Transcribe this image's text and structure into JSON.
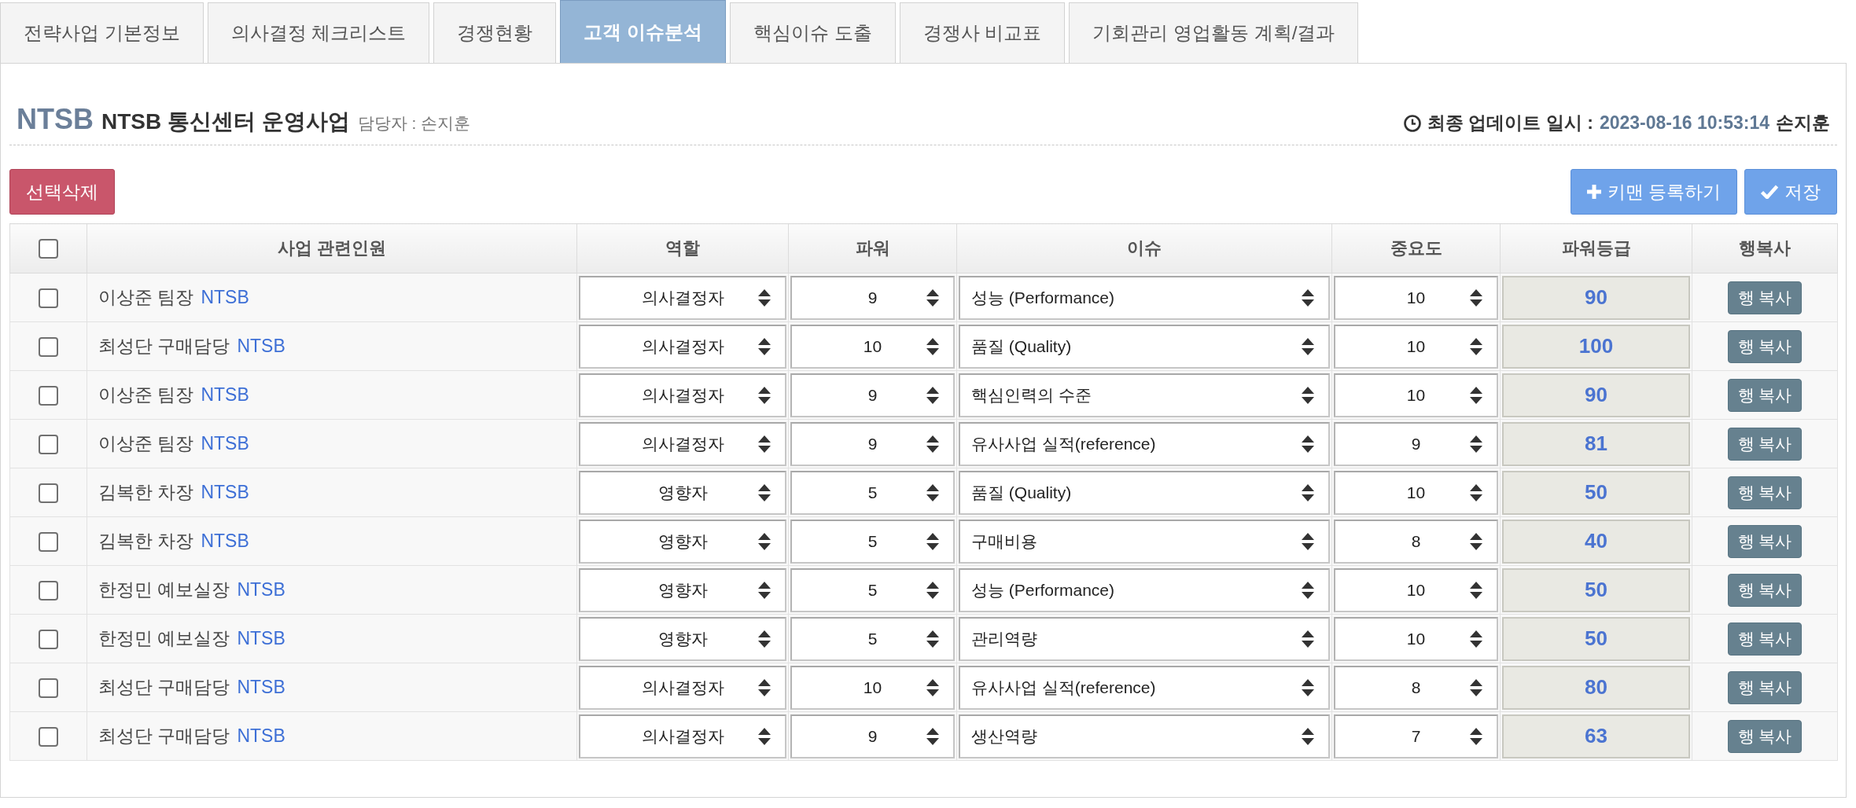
{
  "tabs": [
    {
      "label": "전략사업 기본정보",
      "selected": false
    },
    {
      "label": "의사결정 체크리스트",
      "selected": false
    },
    {
      "label": "경쟁현황",
      "selected": false
    },
    {
      "label": "고객 이슈분석",
      "selected": true
    },
    {
      "label": "핵심이슈 도출",
      "selected": false
    },
    {
      "label": "경쟁사 비교표",
      "selected": false
    },
    {
      "label": "기회관리 영업활동 계획/결과",
      "selected": false
    }
  ],
  "project": {
    "code": "NTSB",
    "title": "NTSB 통신센터 운영사업",
    "manager": "담당자 : 손지훈"
  },
  "last_update": {
    "label": "최종 업데이트 일시 :",
    "timestamp": "2023-08-16 10:53:14",
    "user": "손지훈"
  },
  "actions": [
    {
      "kind": "delete",
      "label": "선택삭제"
    },
    {
      "kind": "add",
      "label": "키맨 등록하기"
    },
    {
      "kind": "save",
      "label": "저장"
    }
  ],
  "table": {
    "select_all": {
      "checked": false
    },
    "columns": [
      "사업 관련인원",
      "역할",
      "파워",
      "이슈",
      "중요도",
      "파워등급",
      "행복사"
    ],
    "rows": [
      {
        "checked": false,
        "person": "이상준 팀장",
        "company": "NTSB",
        "role": "의사결정자",
        "power": "9",
        "issue": "성능 (Performance)",
        "importance": "10",
        "power_grade": "90",
        "copy_button": "행 복사"
      },
      {
        "checked": false,
        "person": "최성단 구매담당",
        "company": "NTSB",
        "role": "의사결정자",
        "power": "10",
        "issue": "품질 (Quality)",
        "importance": "10",
        "power_grade": "100",
        "copy_button": "행 복사"
      },
      {
        "checked": false,
        "person": "이상준 팀장",
        "company": "NTSB",
        "role": "의사결정자",
        "power": "9",
        "issue": "핵심인력의 수준",
        "importance": "10",
        "power_grade": "90",
        "copy_button": "행 복사"
      },
      {
        "checked": false,
        "person": "이상준 팀장",
        "company": "NTSB",
        "role": "의사결정자",
        "power": "9",
        "issue": "유사사업 실적(reference)",
        "importance": "9",
        "power_grade": "81",
        "copy_button": "행 복사"
      },
      {
        "checked": false,
        "person": "김복한 차장",
        "company": "NTSB",
        "role": "영향자",
        "power": "5",
        "issue": "품질 (Quality)",
        "importance": "10",
        "power_grade": "50",
        "copy_button": "행 복사"
      },
      {
        "checked": false,
        "person": "김복한 차장",
        "company": "NTSB",
        "role": "영향자",
        "power": "5",
        "issue": "구매비용",
        "importance": "8",
        "power_grade": "40",
        "copy_button": "행 복사"
      },
      {
        "checked": false,
        "person": "한정민 예보실장",
        "company": "NTSB",
        "role": "영향자",
        "power": "5",
        "issue": "성능 (Performance)",
        "importance": "10",
        "power_grade": "50",
        "copy_button": "행 복사"
      },
      {
        "checked": false,
        "person": "한정민 예보실장",
        "company": "NTSB",
        "role": "영향자",
        "power": "5",
        "issue": "관리역량",
        "importance": "10",
        "power_grade": "50",
        "copy_button": "행 복사"
      },
      {
        "checked": false,
        "person": "최성단 구매담당",
        "company": "NTSB",
        "role": "의사결정자",
        "power": "10",
        "issue": "유사사업 실적(reference)",
        "importance": "8",
        "power_grade": "80",
        "copy_button": "행 복사"
      },
      {
        "checked": false,
        "person": "최성단 구매담당",
        "company": "NTSB",
        "role": "의사결정자",
        "power": "9",
        "issue": "생산역량",
        "importance": "7",
        "power_grade": "63",
        "copy_button": "행 복사"
      }
    ]
  }
}
